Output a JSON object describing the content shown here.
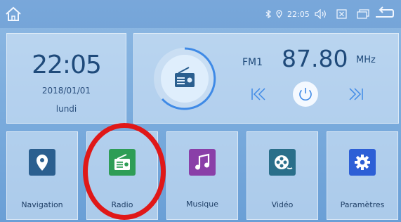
{
  "status_bar": {
    "time": "22:05",
    "icons": [
      "home-icon",
      "bluetooth-icon",
      "location-icon",
      "volume-icon",
      "close-box-icon",
      "recent-apps-icon",
      "back-icon"
    ]
  },
  "clock": {
    "time": "22:05",
    "date": "2018/01/01",
    "day": "lundi"
  },
  "radio": {
    "band": "FM1",
    "frequency": "87.80",
    "unit": "MHz"
  },
  "apps": [
    {
      "label": "Navigation",
      "icon": "location-pin-icon",
      "color": "#2b5f8f"
    },
    {
      "label": "Radio",
      "icon": "radio-icon",
      "color": "#2e9d56"
    },
    {
      "label": "Musique",
      "icon": "music-note-icon",
      "color": "#8a3fa8"
    },
    {
      "label": "Vidéo",
      "icon": "film-reel-icon",
      "color": "#2a6f8a"
    },
    {
      "label": "Paramètres",
      "icon": "gear-icon",
      "color": "#2d5fd6"
    }
  ],
  "colors": {
    "highlight_circle": "#e01818",
    "text": "#1f4a7a"
  }
}
